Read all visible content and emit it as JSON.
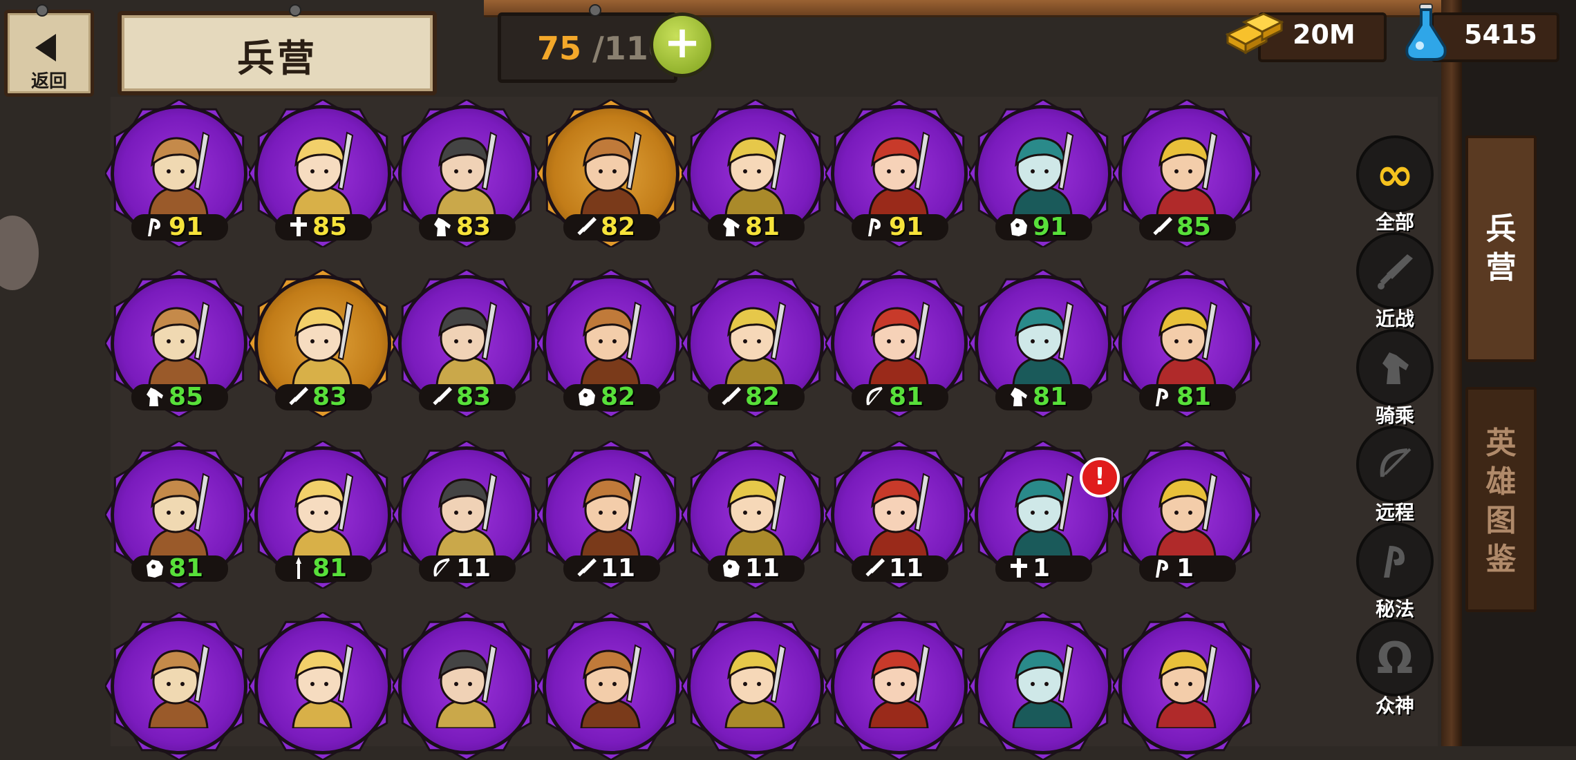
{
  "header": {
    "back_label": "返回",
    "title": "兵营",
    "population": {
      "current": "75",
      "sep_max": "/110"
    },
    "add_label": "+",
    "gold": "20M",
    "potion": "5415"
  },
  "side_tabs": {
    "barracks": "兵\n营",
    "heroes": "英\n雄\n图\n鉴"
  },
  "filters": [
    "全部",
    "近战",
    "骑乘",
    "远程",
    "秘法",
    "众神"
  ],
  "colors": {
    "purple": "#7a1bbd",
    "gold_ring": "#c27c18",
    "level_yellow": "#f6e33a",
    "level_green": "#58e03a"
  },
  "heroes": [
    {
      "level": "91",
      "class_icon": "magic-icon",
      "color": "y",
      "ring": "purple"
    },
    {
      "level": "85",
      "class_icon": "god-icon",
      "color": "y",
      "ring": "purple"
    },
    {
      "level": "83",
      "class_icon": "mount-icon",
      "color": "y",
      "ring": "purple"
    },
    {
      "level": "82",
      "class_icon": "melee-icon",
      "color": "y",
      "ring": "gold"
    },
    {
      "level": "81",
      "class_icon": "mount-icon",
      "color": "y",
      "ring": "purple"
    },
    {
      "level": "91",
      "class_icon": "magic-icon",
      "color": "y",
      "ring": "purple"
    },
    {
      "level": "91",
      "class_icon": "beast-icon",
      "color": "g",
      "ring": "purple"
    },
    {
      "level": "85",
      "class_icon": "melee-icon",
      "color": "g",
      "ring": "purple"
    },
    {
      "level": "85",
      "class_icon": "mount-icon",
      "color": "g",
      "ring": "purple"
    },
    {
      "level": "83",
      "class_icon": "melee-icon",
      "color": "g",
      "ring": "gold"
    },
    {
      "level": "83",
      "class_icon": "melee-icon",
      "color": "g",
      "ring": "purple"
    },
    {
      "level": "82",
      "class_icon": "beast-icon",
      "color": "g",
      "ring": "purple"
    },
    {
      "level": "82",
      "class_icon": "melee-icon",
      "color": "g",
      "ring": "purple"
    },
    {
      "level": "81",
      "class_icon": "ranged-icon",
      "color": "g",
      "ring": "purple"
    },
    {
      "level": "81",
      "class_icon": "mount-icon",
      "color": "g",
      "ring": "purple"
    },
    {
      "level": "81",
      "class_icon": "magic-icon",
      "color": "g",
      "ring": "purple"
    },
    {
      "level": "81",
      "class_icon": "beast-icon",
      "color": "g",
      "ring": "purple"
    },
    {
      "level": "81",
      "class_icon": "spear-icon",
      "color": "g",
      "ring": "purple"
    },
    {
      "level": "11",
      "class_icon": "ranged-icon",
      "color": "w",
      "ring": "purple"
    },
    {
      "level": "11",
      "class_icon": "melee-icon",
      "color": "w",
      "ring": "purple"
    },
    {
      "level": "11",
      "class_icon": "beast-icon",
      "color": "w",
      "ring": "purple"
    },
    {
      "level": "11",
      "class_icon": "melee-icon",
      "color": "w",
      "ring": "purple"
    },
    {
      "level": "1",
      "class_icon": "god-icon",
      "color": "w",
      "ring": "purple"
    },
    {
      "level": "1",
      "class_icon": "magic-icon",
      "color": "w",
      "ring": "purple"
    },
    {
      "level": "",
      "class_icon": "",
      "color": "w",
      "ring": "purple"
    },
    {
      "level": "",
      "class_icon": "",
      "color": "w",
      "ring": "purple"
    },
    {
      "level": "",
      "class_icon": "",
      "color": "w",
      "ring": "purple"
    },
    {
      "level": "",
      "class_icon": "",
      "color": "w",
      "ring": "purple"
    },
    {
      "level": "",
      "class_icon": "",
      "color": "w",
      "ring": "purple"
    },
    {
      "level": "",
      "class_icon": "",
      "color": "w",
      "ring": "purple"
    },
    {
      "level": "",
      "class_icon": "",
      "color": "w",
      "ring": "purple"
    },
    {
      "level": "",
      "class_icon": "",
      "color": "w",
      "ring": "purple"
    }
  ],
  "alert_mark": "!"
}
